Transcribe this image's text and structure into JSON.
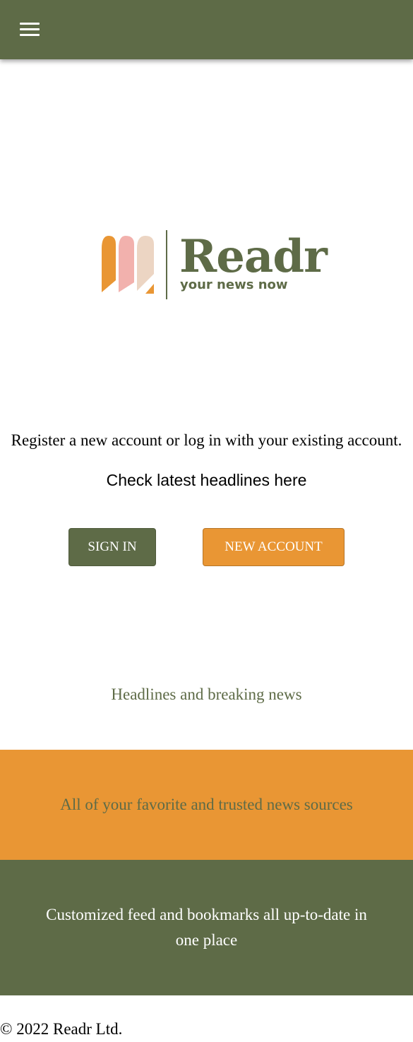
{
  "header": {
    "menu_icon": "hamburger-menu-icon",
    "background_color": "#5e6b47"
  },
  "logo": {
    "wordmark": "Readr",
    "tagline": "your news now",
    "colors": {
      "orange": "#e99634",
      "pink": "#f2b1ad",
      "beige": "#ecd5c3",
      "green": "#5e6b47"
    }
  },
  "intro": {
    "text": "Register a new account or log in with your existing account.",
    "headlines_link": "Check latest headlines here"
  },
  "actions": {
    "sign_in_label": "SIGN IN",
    "new_account_label": "NEW ACCOUNT",
    "sign_in_color": "#5e6b47",
    "new_account_color": "#e99634"
  },
  "features": {
    "item_1": "Headlines and breaking news",
    "item_2": "All of your favorite and trusted news sources",
    "item_3": "Customized feed and bookmarks all up-to-date in one place"
  },
  "footer": {
    "copyright": "© 2022 Readr Ltd."
  }
}
